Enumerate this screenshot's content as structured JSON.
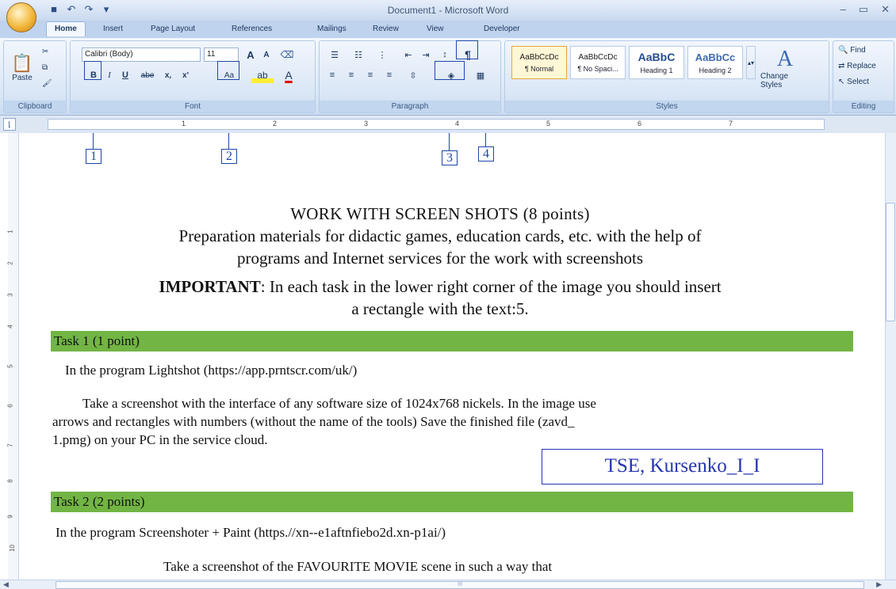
{
  "window": {
    "title": "Document1 - Microsoft Word",
    "office_button_label": "",
    "controls": [
      "–",
      "▭",
      "✕"
    ]
  },
  "qat": [
    "save-icon",
    "undo-icon",
    "redo-icon",
    "customize-icon"
  ],
  "tabs": [
    "Home",
    "Insert",
    "Page Layout",
    "References",
    "Mailings",
    "Review",
    "View",
    "Developer"
  ],
  "active_tab": "Home",
  "ribbon": {
    "clipboard": {
      "paste": "Paste",
      "label": "Clipboard"
    },
    "font": {
      "family": "Calibri (Body)",
      "size": "11",
      "grow": "A",
      "shrink": "A",
      "bold": "B",
      "italic": "I",
      "underline": "U",
      "strike": "abe",
      "sub": "x,",
      "sup": "x'",
      "change_case": "Aa",
      "font_color": "A",
      "label": "Font"
    },
    "paragraph": {
      "show_marks": "¶",
      "label": "Paragraph"
    },
    "styles": {
      "items": [
        {
          "preview": "AaBbCcDc",
          "name": "¶ Normal"
        },
        {
          "preview": "AaBbCcDc",
          "name": "¶ No Spaci..."
        },
        {
          "preview": "AaBbC",
          "name": "Heading 1"
        },
        {
          "preview": "AaBbCc",
          "name": "Heading 2"
        }
      ],
      "change": "Change Styles",
      "label": "Styles"
    },
    "editing": {
      "find": "Find",
      "replace": "Replace",
      "select": "Select",
      "label": "Editing"
    }
  },
  "callouts": [
    "1",
    "2",
    "3",
    "4"
  ],
  "ruler_numbers": [
    "1",
    "2",
    "3",
    "4",
    "5",
    "6",
    "7"
  ],
  "vruler_numbers": [
    "1",
    "2",
    "3",
    "4",
    "5",
    "6",
    "7",
    "8",
    "9",
    "10"
  ],
  "document": {
    "heading": "WORK WITH SCREEN SHOTS (8 points)",
    "subheading_1": "Preparation materials for didactic games, education cards, etc. with the help of",
    "subheading_2": "programs and Internet services for the work with screenshots",
    "important_label": "IMPORTANT",
    "important_text_1": ": In each task in the lower right corner of the image you should insert",
    "important_text_2": "a rectangle with the text:5.",
    "task1_title": "Task 1 (1 point)",
    "task1_program": "In the program Lightshot (https://app.prntscr.com/uk/)",
    "task1_body_1": "Take a screenshot with the interface of any software size of 1024x768 nickels. In the image use",
    "task1_body_2": "arrows and rectangles with numbers (without the name of the tools)  Save the finished file (zavd_",
    "task1_body_3": "1.pmg) on  your PC in the service cloud.",
    "signature": "TSE, Kursenko_I_I",
    "task2_title": "Task 2 (2 points)",
    "task2_program": "In the program Screenshoter + Paint (https.//xn--e1aftnfiebo2d.xn-p1ai/)",
    "task2_body_1": "Take a screenshot of the FAVOURITE MOVIE scene in such a way that"
  },
  "scrollbar_grip": "III"
}
